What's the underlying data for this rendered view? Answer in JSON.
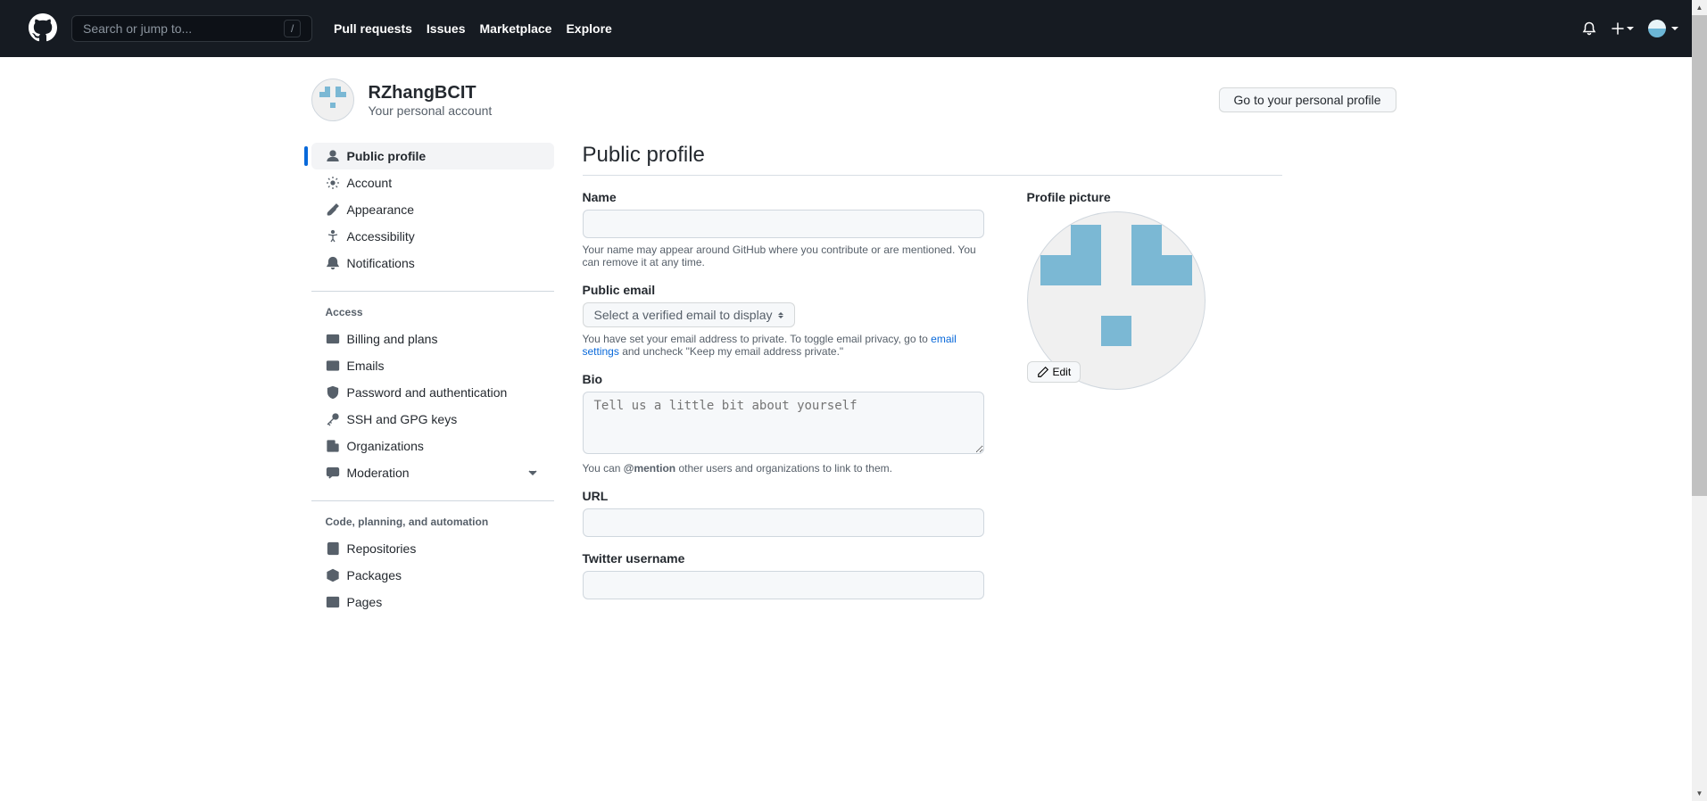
{
  "header": {
    "search_placeholder": "Search or jump to...",
    "nav": [
      "Pull requests",
      "Issues",
      "Marketplace",
      "Explore"
    ]
  },
  "user": {
    "name": "RZhangBCIT",
    "subtitle": "Your personal account",
    "profile_button": "Go to your personal profile"
  },
  "sidebar": {
    "group1": [
      {
        "label": "Public profile",
        "icon": "person"
      },
      {
        "label": "Account",
        "icon": "gear"
      },
      {
        "label": "Appearance",
        "icon": "paintbrush"
      },
      {
        "label": "Accessibility",
        "icon": "accessibility"
      },
      {
        "label": "Notifications",
        "icon": "bell"
      }
    ],
    "group2_title": "Access",
    "group2": [
      {
        "label": "Billing and plans",
        "icon": "credit-card"
      },
      {
        "label": "Emails",
        "icon": "mail"
      },
      {
        "label": "Password and authentication",
        "icon": "shield"
      },
      {
        "label": "SSH and GPG keys",
        "icon": "key"
      },
      {
        "label": "Organizations",
        "icon": "organization"
      },
      {
        "label": "Moderation",
        "icon": "comment-discussion"
      }
    ],
    "group3_title": "Code, planning, and automation",
    "group3": [
      {
        "label": "Repositories",
        "icon": "repo"
      },
      {
        "label": "Packages",
        "icon": "package"
      },
      {
        "label": "Pages",
        "icon": "browser"
      }
    ]
  },
  "main": {
    "title": "Public profile",
    "profile_picture_label": "Profile picture",
    "edit_label": "Edit",
    "fields": {
      "name": {
        "label": "Name",
        "value": "",
        "note": "Your name may appear around GitHub where you contribute or are mentioned. You can remove it at any time."
      },
      "email": {
        "label": "Public email",
        "select_text": "Select a verified email to display",
        "note_pre": "You have set your email address to private. To toggle email privacy, go to ",
        "note_link": "email settings",
        "note_post": " and uncheck \"Keep my email address private.\""
      },
      "bio": {
        "label": "Bio",
        "placeholder": "Tell us a little bit about yourself",
        "note_pre": "You can ",
        "note_bold": "@mention",
        "note_post": " other users and organizations to link to them."
      },
      "url": {
        "label": "URL",
        "value": ""
      },
      "twitter": {
        "label": "Twitter username",
        "value": ""
      }
    }
  }
}
